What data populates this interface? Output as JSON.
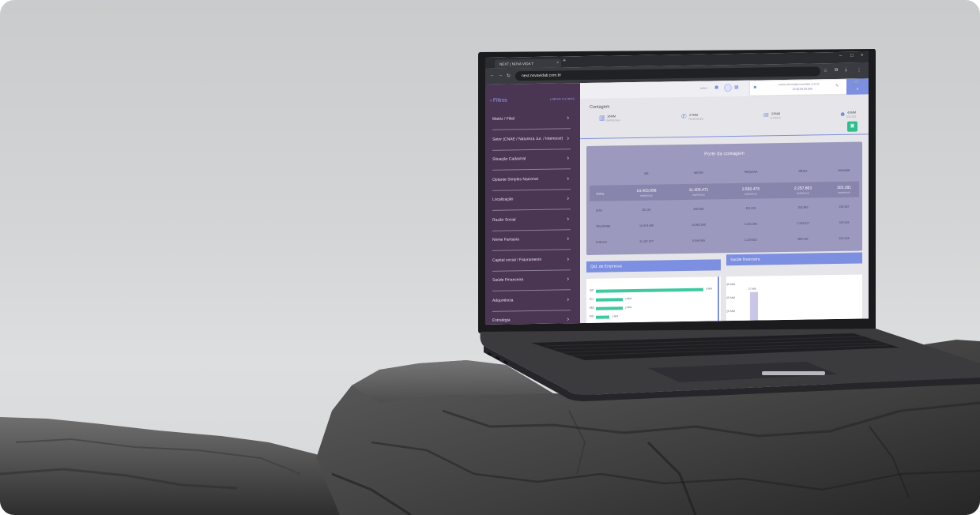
{
  "browser": {
    "tab_title": "NEXT | NOVA VIDA T",
    "tab_close": "×",
    "new_tab": "+",
    "url": "next.novavidati.com.br",
    "window_controls": [
      "–",
      "□",
      "×"
    ]
  },
  "sidebar": {
    "header": "Filtros",
    "clear_label": "LIMPAR FILTROS",
    "items": [
      {
        "label": "Matriz / Filial"
      },
      {
        "label": "Setor (CNAE / Natureza Jur. / Interesse)"
      },
      {
        "label": "Situação Cadastral"
      },
      {
        "label": "Optante Simples Nacional"
      },
      {
        "label": "Localização"
      },
      {
        "label": "Razão Social"
      },
      {
        "label": "Nome Fantasia"
      },
      {
        "label": "Capital social / Faturamento"
      },
      {
        "label": "Saúde Financeira"
      },
      {
        "label": "Adquirência"
      },
      {
        "label": "Estratégia"
      }
    ]
  },
  "topbar": {
    "filter_label": "todos",
    "user_email": "maria.oliveira@novavidati.com.br",
    "user_plan": "ID 00.00.00.000",
    "cart_count": "0"
  },
  "counts": {
    "title": "Contagem",
    "stats": [
      {
        "icon": "building-icon",
        "number": "16MM",
        "label": "EMPRESAS"
      },
      {
        "icon": "phone-icon",
        "number": "27MM",
        "label": "TELEFONES"
      },
      {
        "icon": "mail-icon",
        "number": "23MM",
        "label": "E-MAILS"
      },
      {
        "icon": "person-icon",
        "number": "43MM",
        "label": "SÓCIOS"
      }
    ]
  },
  "porte": {
    "title": "Porte da contagem",
    "columns": [
      "ME",
      "MICRO",
      "PEQUENA",
      "MÉDIA",
      "GRANDE"
    ],
    "rows": [
      {
        "label": "TOTAL",
        "values": [
          "14.403.996",
          "11.405.471",
          "2.582.475",
          "2.257.863",
          "303.381"
        ],
        "subs": [
          "EMPRESAS",
          "EMPRESAS",
          "EMPRESAS",
          "EMPRESAS",
          "EMPRESAS"
        ]
      },
      {
        "label": "SITE",
        "values": [
          "65.131",
          "696.828",
          "251.515",
          "252.843",
          "230.307"
        ]
      },
      {
        "label": "TELEFONE",
        "values": [
          "14.374.440",
          "14.962.590",
          "4.252.266",
          "1.154.517",
          "370.119"
        ]
      },
      {
        "label": "E-MAILS",
        "values": [
          "11.437.977",
          "5.544.955",
          "1.219.822",
          "858.196",
          "221.918"
        ]
      }
    ]
  },
  "panels": {
    "left_title": "Qtd. de Empresas",
    "right_title": "Saúde financeira"
  },
  "chart_data": [
    {
      "type": "bar",
      "title": "Qtd. de Empresas",
      "categories": [
        "SP",
        "RJ",
        "MG",
        "PR"
      ],
      "values": [
        8,
        2,
        2,
        1
      ],
      "value_labels": [
        "8 MM",
        "2 MM",
        "2 MM",
        "1 MM"
      ],
      "orientation": "horizontal"
    },
    {
      "type": "bar",
      "title": "Saúde financeira",
      "yticks": [
        "30 MM",
        "25 MM",
        "20 MM"
      ],
      "values": [
        27
      ],
      "value_labels": [
        "27 MM"
      ]
    }
  ],
  "colors": {
    "sidebar": "#4a3553",
    "accent": "#7d8fe0",
    "bar": "#3ec9a0",
    "porte_bg": "#9c99bf"
  }
}
